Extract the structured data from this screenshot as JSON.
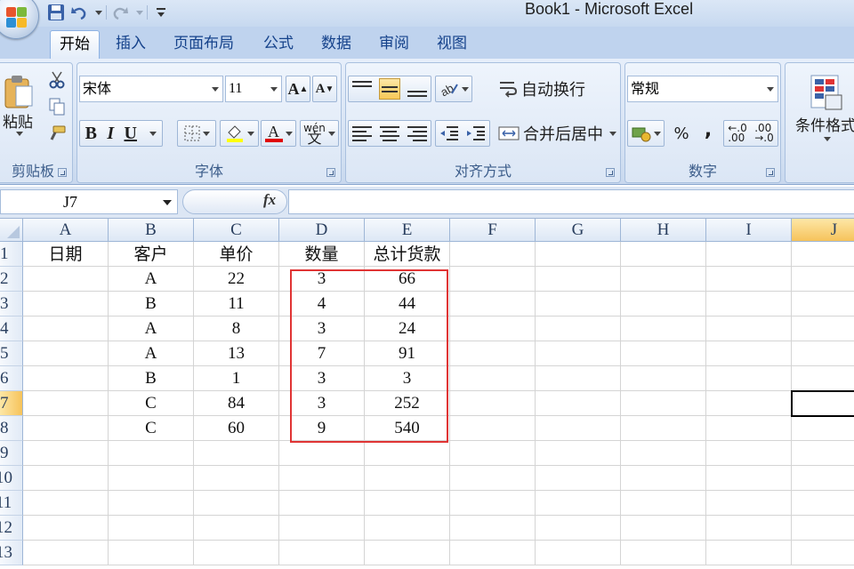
{
  "window": {
    "title": "Book1 - Microsoft Excel"
  },
  "ribbon": {
    "tabs": [
      "开始",
      "插入",
      "页面布局",
      "公式",
      "数据",
      "审阅",
      "视图"
    ],
    "active_tab": "开始",
    "clipboard": {
      "label": "剪贴板",
      "paste_label": "粘贴"
    },
    "font": {
      "label": "字体",
      "font_name": "宋体",
      "font_size": "11",
      "bold": "B",
      "italic": "I",
      "underline": "U",
      "font_color_glyph": "A",
      "grow_glyph": "A",
      "shrink_glyph": "A",
      "phonetic_glyph": "wén"
    },
    "alignment": {
      "label": "对齐方式",
      "wrap_text": "自动换行",
      "merge_center": "合并后居中"
    },
    "number": {
      "label": "数字",
      "format": "常规",
      "percent": "%",
      "comma": ","
    },
    "styles": {
      "conditional_format": "条件格式"
    }
  },
  "formula_bar": {
    "name_box": "J7",
    "fx": "fx",
    "formula": ""
  },
  "sheet": {
    "columns": [
      "A",
      "B",
      "C",
      "D",
      "E",
      "F",
      "G",
      "H",
      "I",
      "J"
    ],
    "selected_column": "J",
    "row_numbers": [
      "1",
      "2",
      "3",
      "4",
      "5",
      "6",
      "7",
      "8",
      "9",
      "10",
      "11",
      "12",
      "13"
    ],
    "selected_row": "7",
    "active_cell": "J7",
    "rows": [
      [
        "日期",
        "客户",
        "单价",
        "数量",
        "总计货款"
      ],
      [
        "",
        "A",
        "22",
        "3",
        "66"
      ],
      [
        "",
        "B",
        "11",
        "4",
        "44"
      ],
      [
        "",
        "A",
        "8",
        "3",
        "24"
      ],
      [
        "",
        "A",
        "13",
        "7",
        "91"
      ],
      [
        "",
        "B",
        "1",
        "3",
        "3"
      ],
      [
        "",
        "C",
        "84",
        "3",
        "252"
      ],
      [
        "",
        "C",
        "60",
        "9",
        "540"
      ]
    ],
    "highlight_range": "D2:E8",
    "highlight_color": "#e03434"
  }
}
